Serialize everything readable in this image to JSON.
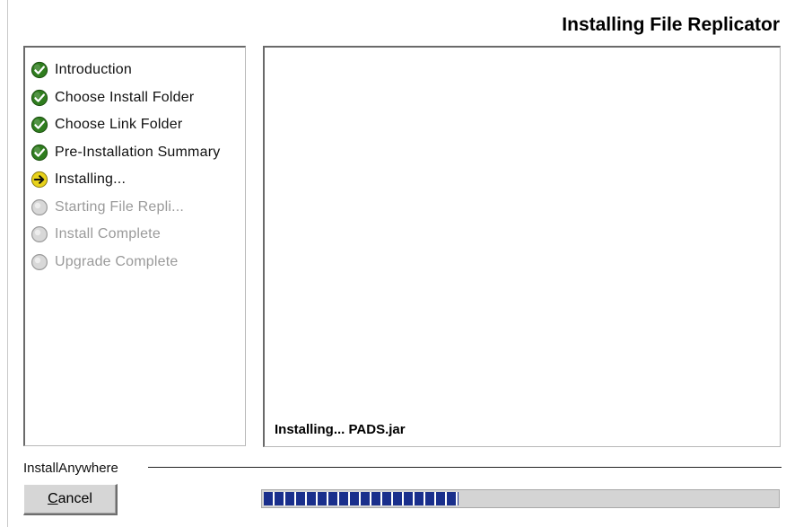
{
  "header": {
    "title": "Installing File Replicator"
  },
  "steps": [
    {
      "label": "Introduction",
      "state": "done",
      "icon": "check-circle-icon"
    },
    {
      "label": "Choose Install Folder",
      "state": "done",
      "icon": "check-circle-icon"
    },
    {
      "label": "Choose Link Folder",
      "state": "done",
      "icon": "check-circle-icon"
    },
    {
      "label": "Pre-Installation Summary",
      "state": "done",
      "icon": "check-circle-icon"
    },
    {
      "label": "Installing...",
      "state": "current",
      "icon": "arrow-right-circle-icon"
    },
    {
      "label": "Starting File Repli...",
      "state": "pending",
      "icon": "empty-circle-icon"
    },
    {
      "label": "Install Complete",
      "state": "pending",
      "icon": "empty-circle-icon"
    },
    {
      "label": "Upgrade Complete",
      "state": "pending",
      "icon": "empty-circle-icon"
    }
  ],
  "content": {
    "status": "Installing... PADS.jar"
  },
  "footer": {
    "vendor": "InstallAnywhere",
    "cancel_label": "Cancel",
    "cancel_mnemonic": "C",
    "cancel_rest": "ancel"
  },
  "progress": {
    "fraction": 0.38
  },
  "colors": {
    "done": "#2f7d1e",
    "current": "#e8d21a",
    "pending": "#d8d8d8",
    "progress_fill": "#1a2f8c"
  }
}
